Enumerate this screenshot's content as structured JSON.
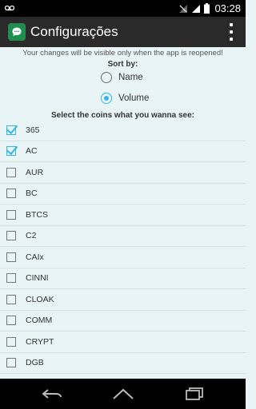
{
  "status_bar": {
    "time": "03:28",
    "icons": [
      "voicemail-icon",
      "signal-off-icon",
      "signal-icon",
      "battery-icon"
    ]
  },
  "action_bar": {
    "title": "Configurações",
    "app_icon": "chat-bubble-icon",
    "menu_icon": "overflow-menu-icon"
  },
  "settings": {
    "notice": "Your changes will be visible only when the app is reopened!",
    "sort_label": "Sort by:",
    "sort_options": [
      {
        "label": "Name",
        "selected": false
      },
      {
        "label": "Volume",
        "selected": true
      }
    ],
    "coins_label": "Select the coins what you wanna see:",
    "coins": [
      {
        "label": "365",
        "checked": true
      },
      {
        "label": "AC",
        "checked": true
      },
      {
        "label": "AUR",
        "checked": false
      },
      {
        "label": "BC",
        "checked": false
      },
      {
        "label": "BTCS",
        "checked": false
      },
      {
        "label": "C2",
        "checked": false
      },
      {
        "label": "CAIx",
        "checked": false
      },
      {
        "label": "CINNI",
        "checked": false
      },
      {
        "label": "CLOAK",
        "checked": false
      },
      {
        "label": "COMM",
        "checked": false
      },
      {
        "label": "CRYPT",
        "checked": false
      },
      {
        "label": "DGB",
        "checked": false
      }
    ]
  },
  "nav_bar": {
    "buttons": [
      "back-icon",
      "home-icon",
      "recent-apps-icon"
    ]
  },
  "colors": {
    "accent": "#33b5e5",
    "background": "#e9f4f6",
    "action_bar": "#2a2a2a",
    "app_icon": "#1e8f4e"
  }
}
